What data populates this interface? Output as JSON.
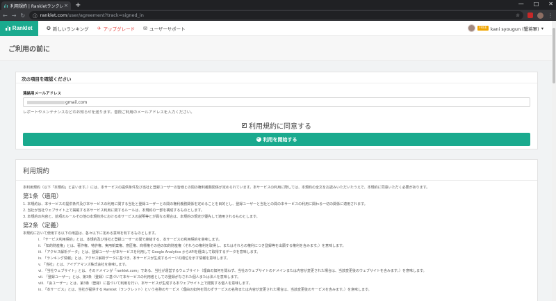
{
  "browser": {
    "tab_title": "利用規約 | Rankletランクレット",
    "tab_close": "×",
    "new_tab": "+",
    "window_controls": [
      "—",
      "□",
      "✕"
    ],
    "url_host": "ranklet.com",
    "url_path": "/user/agreement?track=signed_in",
    "url_prefix": "ⓘ",
    "nav_icons": [
      "←",
      "→",
      "↻"
    ],
    "right_icons": [
      "☆",
      "⋮"
    ]
  },
  "header": {
    "brand": "Ranklet",
    "nav": [
      {
        "icon": "✪",
        "label": "新しいランキング"
      },
      {
        "icon": "✈",
        "label": "アップグレード"
      },
      {
        "icon": "✉",
        "label": "ユーザーサポート"
      }
    ],
    "user_badge": "FREE",
    "user_name": "kani syougun (蟹将軍)",
    "user_caret": "▾"
  },
  "page": {
    "title": "ご利用の前に"
  },
  "confirm_card": {
    "heading": "次の項目を確認ください",
    "email_label": "連絡用メールアドレス",
    "email_value": "gmail.com",
    "help_text": "レポートやメンテナンスなどのお知らせを送ります。普段ご利用のメールアドレスを入力ください。",
    "agree_check": "✔",
    "agree_label": "利用規約に同意する",
    "start_check": "✔",
    "start_label": "利用を開始する"
  },
  "terms": {
    "title": "利用規約",
    "intro": "本利用規約（以下「本規約」と言います。）には、本サービスの提供条件及び当社と登録ユーザーの皆様との間の権利義務関係が定められています。本サービスの利用に際しては、本規約の全文をお読みいただいたうえで、本規約に同意いただく必要があります。",
    "art1_title": "第1条（適用）",
    "art1_items": [
      "1. 本規約は、本サービスの提供条件及び本サービスの利用に関する当社と登録ユーザーとの間の権利義務関係を定めることを目的とし、登録ユーザーと当社との間の本サービスの利用に関わる一切の関係に適用されます。",
      "2. 当社が当社ウェブサイト上で掲載する本サービス利用に関するルールは、本規約の一部を構成するものとします。",
      "3. 本規約の内容と、前項のルールその他の本規約外における本サービスの説明等とが異なる場合は、本規約の規定が優先して適用されるものとします。"
    ],
    "art2_title": "第2条（定義）",
    "art2_intro": "本規約において使用する以下の用語は、各々以下に定める意味を有するものとします。",
    "art2_items": [
      "i. 「サービス利用契約」とは、本規約及び当社と登録ユーザーの間で締結する、本サービスの利用契約を意味します。",
      "ii. 「知的財産権」とは、著作権、特許権、実用新案権、意匠権、商標権その他の知的財産権（それらの権利を取得し、またはそれらの権利につき登録等を出願する権利を含みます。）を意味します。",
      "iii. 「アクセス解析データ」とは、登録ユーザーが本サービスを利用して Google Analytics からAPIを経由して取得するデータを意味します。",
      "iv. 「ランキング情報」とは、アクセス解析データに基づき、本サービスが生成するページの順位を示す情報を意味します。",
      "v. 「当社」とは、アイデアマンズ株式会社を意味します。",
      "vi. 「当社ウェブサイト」とは、そのドメインが「ranklet.com」である、当社が運営するウェブサイト（理由の如何を問わず、当社のウェブサイトのドメインまたは内容が変更された場合は、当該変更後のウェブサイトを含みます。）を意味します。",
      "vii. 「登録ユーザー」とは、第3条（登録）に基づいて本サービスの利用者としての登録がなされた個人または法人を意味します。",
      "viii. 「会ユーザー」とは、第3条（登録）に基づいて利用を行い、本サービスが生成する本ウェブサイト上で閲覧する個人を意味します。",
      "ix. 「本サービス」とは、当社が提供する Ranklet（ランクレット）という名称のサービス（理由の如何を問わずサービスの名称または内容が変更された場合は、当該変更後のサービスを含みます。）を意味します。"
    ]
  }
}
